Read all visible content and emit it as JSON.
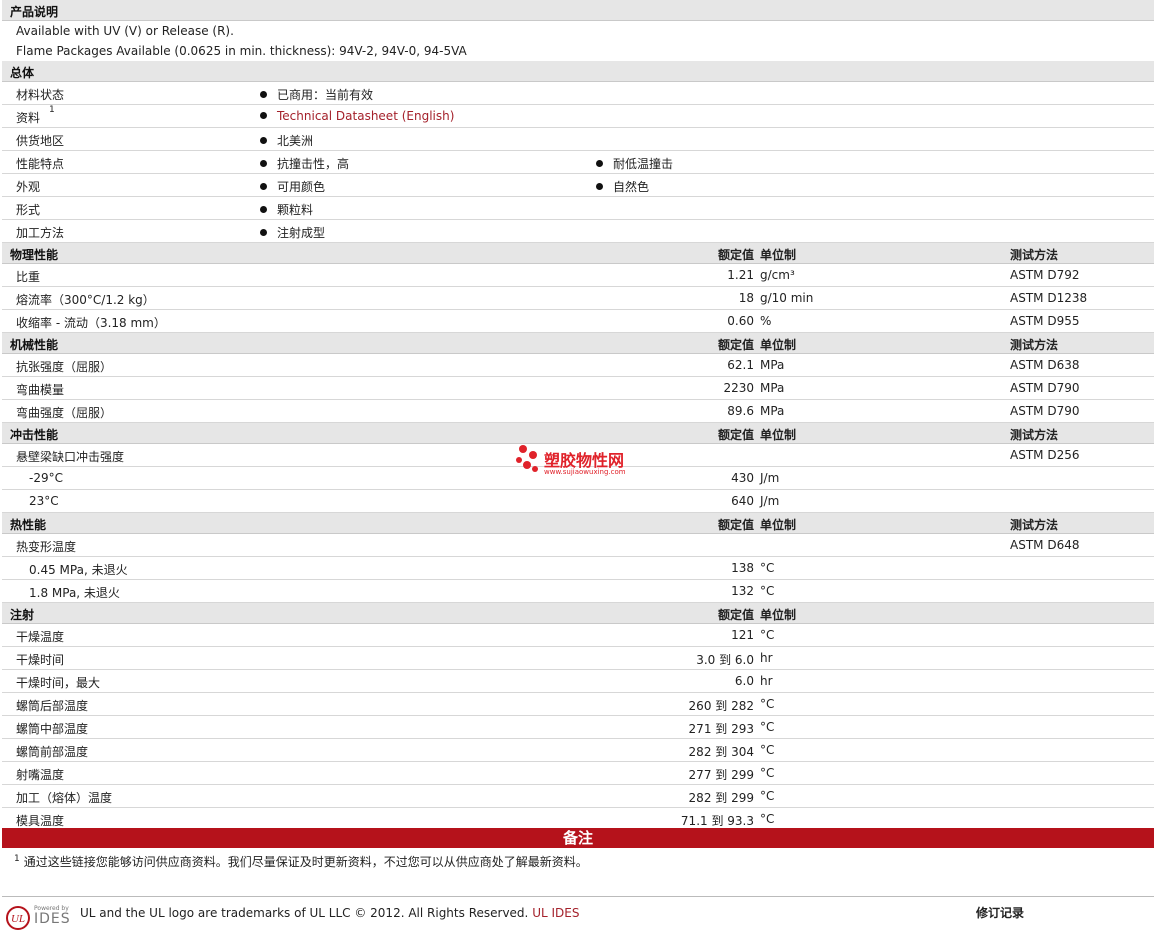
{
  "desc": {
    "title": "产品说明",
    "line1": "Available with UV (V) or Release (R).",
    "line2": "Flame Packages Available (0.0625 in min. thickness): 94V-2, 94V-0, 94-5VA"
  },
  "general": {
    "title": "总体",
    "rows": [
      {
        "label": "材料状态",
        "b1": "已商用：当前有效",
        "b2": ""
      },
      {
        "label": "资料",
        "sup": "1",
        "b1": "Technical Datasheet (English)",
        "b2": ""
      },
      {
        "label": "供货地区",
        "b1": "北美洲",
        "b2": ""
      },
      {
        "label": "性能特点",
        "b1": "抗撞击性，高",
        "b2": "耐低温撞击"
      },
      {
        "label": "外观",
        "b1": "可用颜色",
        "b2": "自然色"
      },
      {
        "label": "形式",
        "b1": "颗粒料",
        "b2": ""
      },
      {
        "label": "加工方法",
        "b1": "注射成型",
        "b2": ""
      }
    ]
  },
  "cols": {
    "nominal": "额定值",
    "unit": "单位制",
    "test": "测试方法"
  },
  "physical": {
    "title": "物理性能",
    "rows": [
      {
        "label": "比重",
        "value": "1.21",
        "unit": "g/cm³",
        "test": "ASTM D792"
      },
      {
        "label": "熔流率（300°C/1.2 kg）",
        "value": "18",
        "unit": "g/10 min",
        "test": "ASTM D1238"
      },
      {
        "label": "收缩率 - 流动（3.18 mm）",
        "value": "0.60",
        "unit": "%",
        "test": "ASTM D955"
      }
    ]
  },
  "mechanical": {
    "title": "机械性能",
    "rows": [
      {
        "label": "抗张强度（屈服）",
        "value": "62.1",
        "unit": "MPa",
        "test": "ASTM D638"
      },
      {
        "label": "弯曲模量",
        "value": "2230",
        "unit": "MPa",
        "test": "ASTM D790"
      },
      {
        "label": "弯曲强度（屈服）",
        "value": "89.6",
        "unit": "MPa",
        "test": "ASTM D790"
      }
    ]
  },
  "impact": {
    "title": "冲击性能",
    "rows": [
      {
        "label": "悬壁梁缺口冲击强度",
        "value": "",
        "unit": "",
        "test": "ASTM D256"
      },
      {
        "label": "-29°C",
        "value": "430",
        "unit": "J/m",
        "test": ""
      },
      {
        "label": "23°C",
        "value": "640",
        "unit": "J/m",
        "test": ""
      }
    ]
  },
  "thermal": {
    "title": "热性能",
    "rows": [
      {
        "label": "热变形温度",
        "value": "",
        "unit": "",
        "test": "ASTM D648"
      },
      {
        "label": "0.45 MPa, 未退火",
        "value": "138",
        "unit": "°C",
        "test": ""
      },
      {
        "label": "1.8 MPa, 未退火",
        "value": "132",
        "unit": "°C",
        "test": ""
      }
    ]
  },
  "injection": {
    "title": "注射",
    "rows": [
      {
        "label": "干燥温度",
        "value": "121",
        "unit": "°C"
      },
      {
        "label": "干燥时间",
        "value": "3.0 到  6.0",
        "unit": "hr"
      },
      {
        "label": "干燥时间，最大",
        "value": "6.0",
        "unit": "hr"
      },
      {
        "label": "螺筒后部温度",
        "value": "260 到  282",
        "unit": "°C"
      },
      {
        "label": "螺筒中部温度",
        "value": "271 到  293",
        "unit": "°C"
      },
      {
        "label": "螺筒前部温度",
        "value": "282 到  304",
        "unit": "°C"
      },
      {
        "label": "射嘴温度",
        "value": "277 到  299",
        "unit": "°C"
      },
      {
        "label": "加工（熔体）温度",
        "value": "282 到  299",
        "unit": "°C"
      },
      {
        "label": "模具温度",
        "value": "71.1 到  93.3",
        "unit": "°C"
      }
    ]
  },
  "notes": {
    "title": "备注",
    "footnote_num": "1",
    "footnote": "通过这些链接您能够访问供应商资料。我们尽量保证及时更新资料，不过您可以从供应商处了解最新资料。"
  },
  "watermark": {
    "name": "塑胶物性网",
    "url": "www.sujiaowuxing.com"
  },
  "footer": {
    "logo_small": "Powered by",
    "logo_main": "IDES",
    "text": "UL and the UL logo are trademarks of UL LLC © 2012. All Rights Reserved.",
    "link": "UL IDES",
    "revision": "修订记录"
  }
}
